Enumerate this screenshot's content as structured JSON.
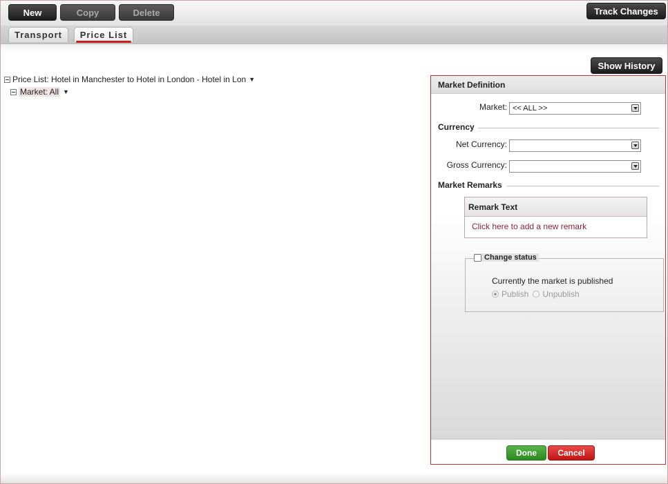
{
  "toolbar": {
    "new_label": "New",
    "copy_label": "Copy",
    "delete_label": "Delete",
    "track_changes_label": "Track Changes"
  },
  "tabs": [
    {
      "label": "Transport"
    },
    {
      "label": "Price List"
    }
  ],
  "show_history_label": "Show History",
  "tree": {
    "root_label": "Price List: Hotel in Manchester to Hotel in London - Hotel in Lon",
    "child_label": "Market: All",
    "caret": "▼"
  },
  "panel": {
    "title": "Market Definition",
    "market_label": "Market:",
    "market_value": "<< ALL >>",
    "currency_section": "Currency",
    "net_currency_label": "Net Currency:",
    "net_currency_value": "",
    "gross_currency_label": "Gross Currency:",
    "gross_currency_value": "",
    "remarks_section": "Market Remarks",
    "remark_header": "Remark Text",
    "add_remark_link": "Click here to add a new remark",
    "change_status_label": "Change status",
    "status_text": "Currently the market is published",
    "publish_label": "Publish",
    "unpublish_label": "Unpublish",
    "done_label": "Done",
    "cancel_label": "Cancel"
  }
}
